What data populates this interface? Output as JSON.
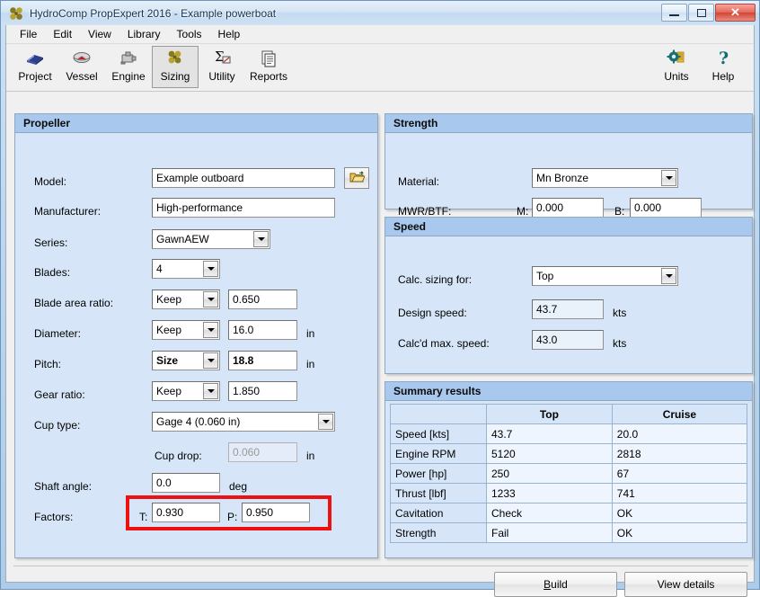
{
  "window": {
    "title": "HydroComp PropExpert 2016 - Example powerboat",
    "app_icon": "propeller-icon",
    "minimize_label": "Minimize",
    "maximize_label": "Maximize",
    "close_label": "✕"
  },
  "menubar": {
    "items": [
      "File",
      "Edit",
      "View",
      "Library",
      "Tools",
      "Help"
    ]
  },
  "toolbar": {
    "left_items": [
      {
        "label": "Project",
        "icon": "book-icon"
      },
      {
        "label": "Vessel",
        "icon": "boat-icon"
      },
      {
        "label": "Engine",
        "icon": "engine-icon"
      },
      {
        "label": "Sizing",
        "icon": "propeller-icon",
        "active": true
      },
      {
        "label": "Utility",
        "icon": "sigma-icon"
      },
      {
        "label": "Reports",
        "icon": "documents-icon"
      }
    ],
    "right_items": [
      {
        "label": "Units",
        "icon": "gear-icon"
      },
      {
        "label": "Help",
        "icon": "question-icon"
      }
    ]
  },
  "propeller": {
    "title": "Propeller",
    "model": {
      "label": "Model:",
      "value": "Example outboard"
    },
    "browse": {
      "icon": "open-folder-icon"
    },
    "manufacturer": {
      "label": "Manufacturer:",
      "value": "High-performance"
    },
    "series": {
      "label": "Series:",
      "value": "GawnAEW"
    },
    "blades": {
      "label": "Blades:",
      "value": "4"
    },
    "blade_area_ratio": {
      "label": "Blade area ratio:",
      "mode": "Keep",
      "value": "0.650"
    },
    "diameter": {
      "label": "Diameter:",
      "mode": "Keep",
      "value": "16.0",
      "unit": "in"
    },
    "pitch": {
      "label": "Pitch:",
      "mode": "Size",
      "value": "18.8",
      "unit": "in"
    },
    "gear_ratio": {
      "label": "Gear ratio:",
      "mode": "Keep",
      "value": "1.850"
    },
    "cup_type": {
      "label": "Cup type:",
      "value": "Gage 4 (0.060 in)"
    },
    "cup_drop": {
      "label": "Cup drop:",
      "value": "0.060",
      "unit": "in"
    },
    "shaft_angle": {
      "label": "Shaft angle:",
      "value": "0.0",
      "unit": "deg"
    },
    "factors": {
      "label": "Factors:",
      "t_label": "T:",
      "t_value": "0.930",
      "p_label": "P:",
      "p_value": "0.950",
      "highlight_color": "#ee1111"
    }
  },
  "strength": {
    "title": "Strength",
    "material": {
      "label": "Material:",
      "value": "Mn Bronze"
    },
    "mwr_btf": {
      "label": "MWR/BTF:",
      "m_label": "M:",
      "m_value": "0.000",
      "b_label": "B:",
      "b_value": "0.000"
    }
  },
  "speed": {
    "title": "Speed",
    "calc_sizing_for": {
      "label": "Calc. sizing for:",
      "value": "Top"
    },
    "design_speed": {
      "label": "Design speed:",
      "value": "43.7",
      "unit": "kts"
    },
    "calcd_max_speed": {
      "label": "Calc'd max. speed:",
      "value": "43.0",
      "unit": "kts"
    }
  },
  "summary": {
    "title": "Summary results",
    "columns": [
      "",
      "Top",
      "Cruise"
    ],
    "rows": [
      {
        "name": "Speed [kts]",
        "top": "43.7",
        "cruise": "20.0"
      },
      {
        "name": "Engine RPM",
        "top": "5120",
        "cruise": "2818"
      },
      {
        "name": "Power [hp]",
        "top": "250",
        "cruise": "67"
      },
      {
        "name": "Thrust [lbf]",
        "top": "1233",
        "cruise": "741"
      },
      {
        "name": "Cavitation",
        "top": "Check",
        "cruise": "OK"
      },
      {
        "name": "Strength",
        "top": "Fail",
        "cruise": "OK"
      }
    ]
  },
  "actions": {
    "build_accel": "B",
    "build_rest": "uild",
    "view_details": "View details"
  }
}
